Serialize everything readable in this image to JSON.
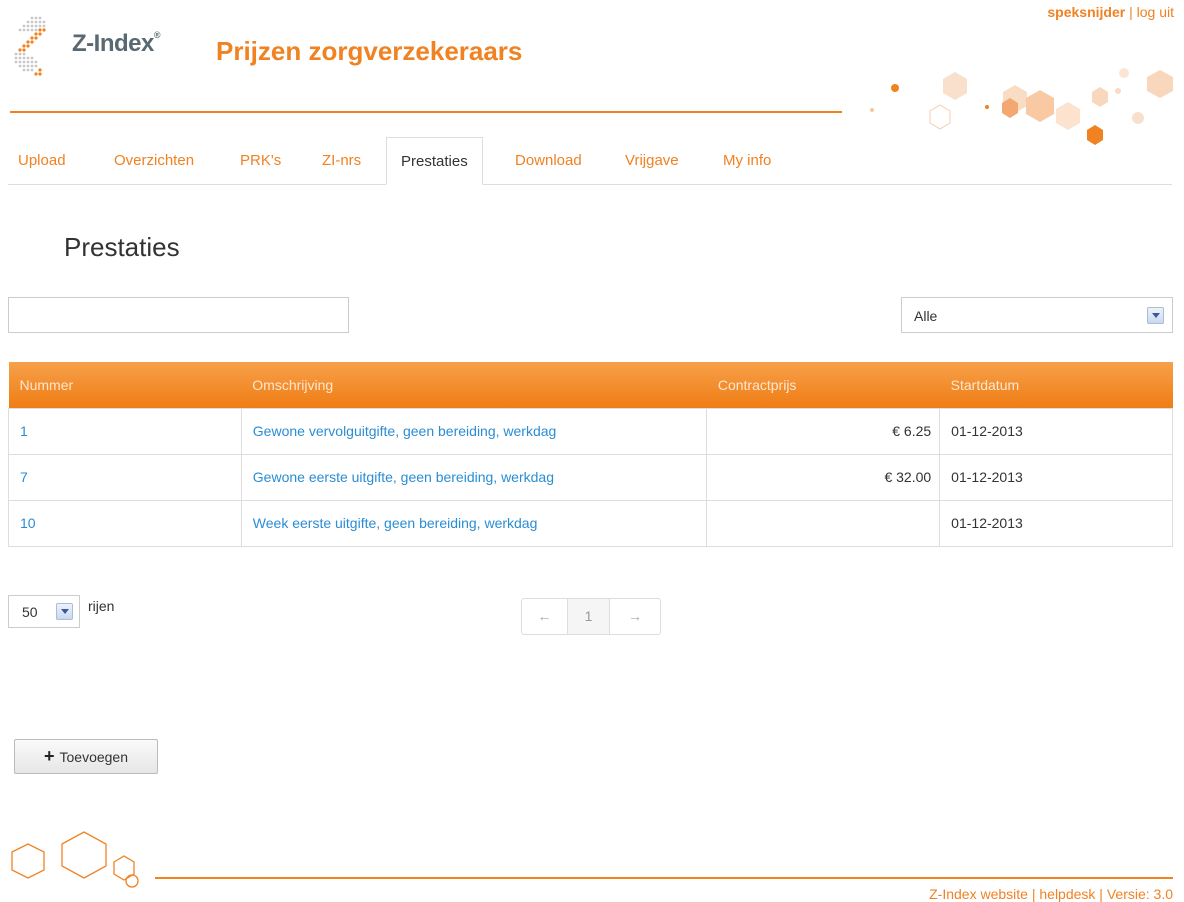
{
  "header": {
    "brand_name": "Z-Index",
    "brand_reg": "®",
    "app_title": "Prijzen zorgverzekeraars",
    "username": "speksnijder",
    "separator": " | ",
    "logout_label": "log uit"
  },
  "tabs": [
    {
      "label": "Upload",
      "active": false
    },
    {
      "label": "Overzichten",
      "active": false
    },
    {
      "label": "PRK's",
      "active": false
    },
    {
      "label": "ZI-nrs",
      "active": false
    },
    {
      "label": "Prestaties",
      "active": true
    },
    {
      "label": "Download",
      "active": false
    },
    {
      "label": "Vrijgave",
      "active": false
    },
    {
      "label": "My info",
      "active": false
    }
  ],
  "page": {
    "title": "Prestaties"
  },
  "filters": {
    "search_value": "",
    "select_value": "Alle"
  },
  "table": {
    "columns": [
      "Nummer",
      "Omschrijving",
      "Contractprijs",
      "Startdatum"
    ],
    "rows": [
      {
        "nummer": "1",
        "omschrijving": "Gewone vervolguitgifte, geen bereiding, werkdag",
        "contractprijs": "€ 6.25",
        "startdatum": "01-12-2013"
      },
      {
        "nummer": "7",
        "omschrijving": "Gewone eerste uitgifte, geen bereiding, werkdag",
        "contractprijs": "€ 32.00",
        "startdatum": "01-12-2013"
      },
      {
        "nummer": "10",
        "omschrijving": "Week eerste uitgifte, geen bereiding, werkdag",
        "contractprijs": "",
        "startdatum": "01-12-2013"
      }
    ]
  },
  "paging": {
    "rows_value": "50",
    "rows_label": "rijen",
    "prev": "←",
    "current_page": "1",
    "next": "→"
  },
  "actions": {
    "add_label": "Toevoegen"
  },
  "footer": {
    "website": "Z-Index website",
    "sep": " | ",
    "helpdesk": "helpdesk",
    "version": "Versie: 3.0"
  },
  "colors": {
    "accent": "#f08222",
    "link": "#2a8dd4",
    "text": "#333333"
  }
}
